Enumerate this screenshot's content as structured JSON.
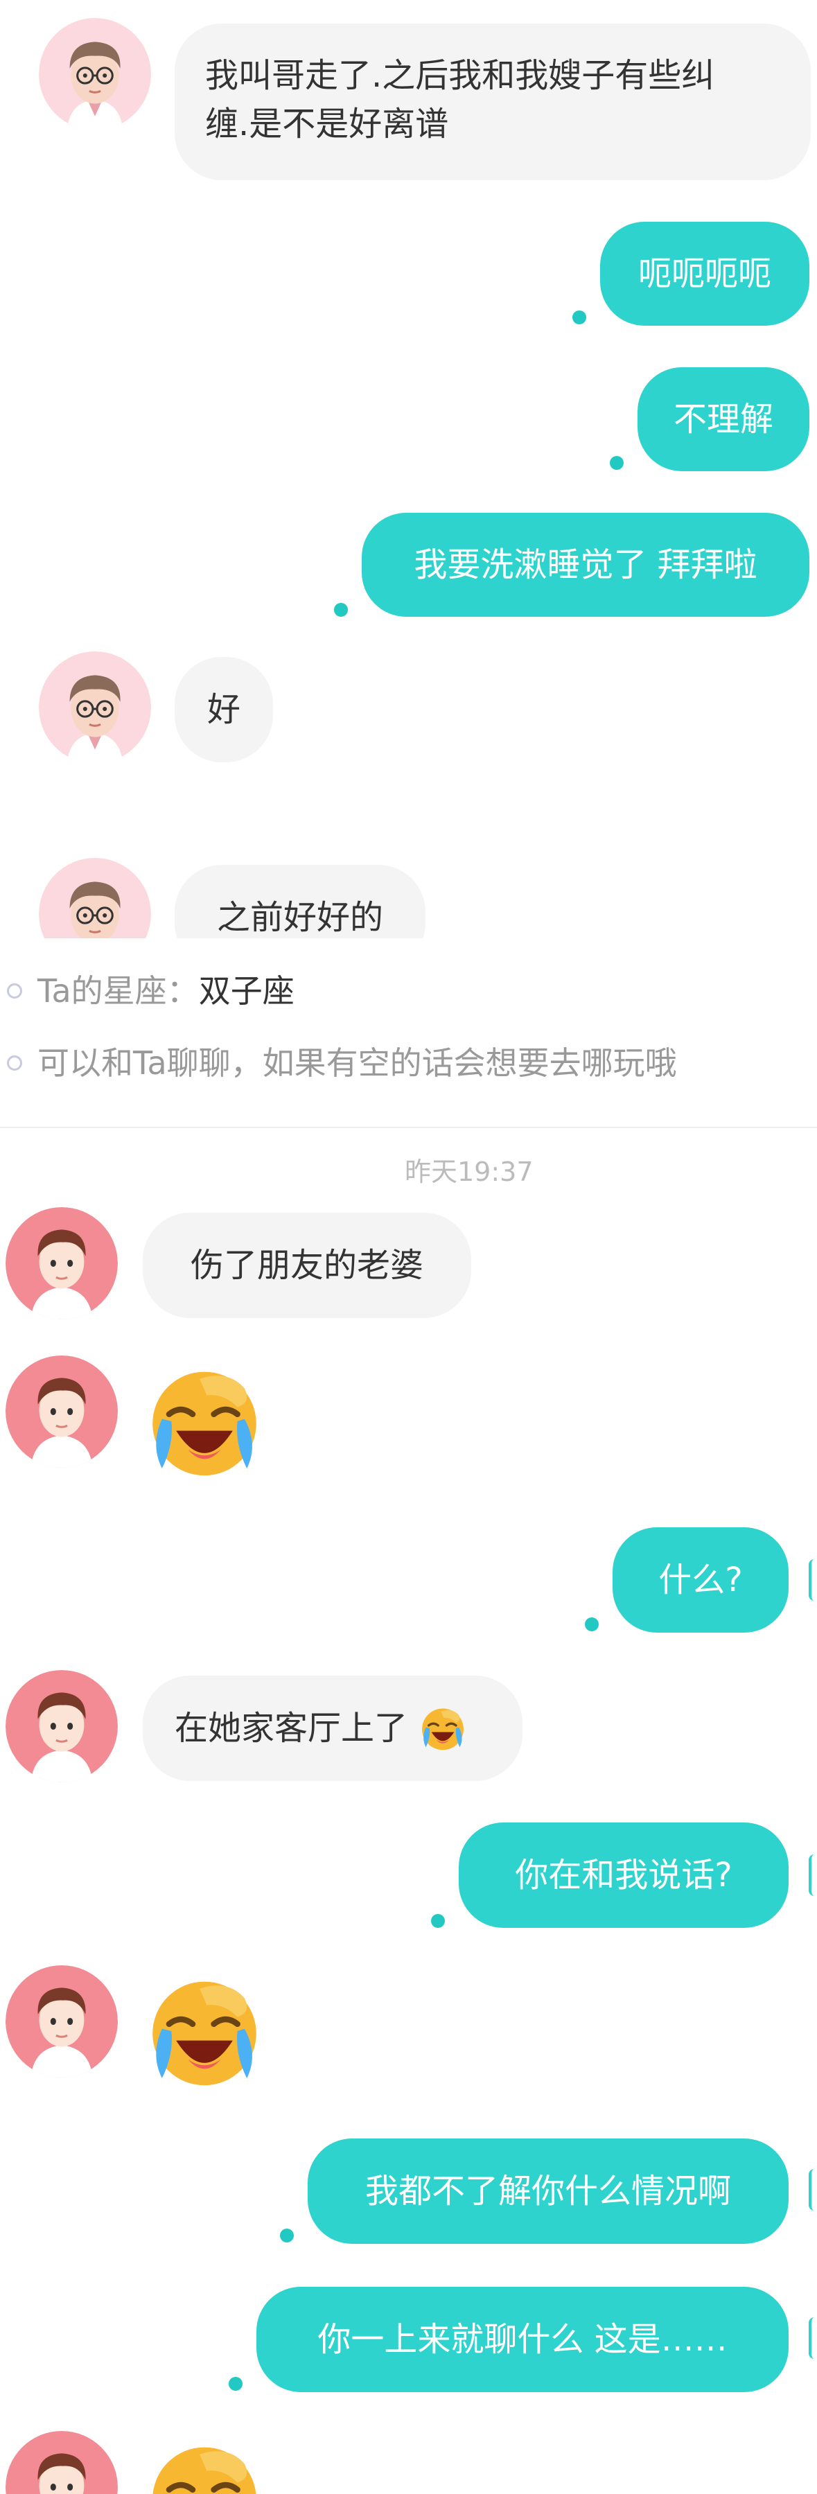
{
  "top_section": {
    "messages": [
      {
        "from": "them",
        "text": "我叫哥走了.之后我和我嫂子有些纠"
      },
      {
        "from": "them",
        "text": "缠.是不是好离谱"
      },
      {
        "from": "me",
        "text": "呃呃呃呃"
      },
      {
        "from": "me",
        "text": "不理解"
      },
      {
        "from": "me",
        "text": "我要洗漱睡觉了 拜拜啦"
      },
      {
        "from": "them",
        "text": "好"
      },
      {
        "from": "them",
        "text": "之前好好的"
      }
    ]
  },
  "profile_info": {
    "zodiac_label": "Ta的星座：",
    "zodiac_value": "双子座",
    "prompt": "可以和Ta聊聊，如果有空的话会想要去哪玩哦"
  },
  "timestamp": "昨天19:37",
  "bottom_section": {
    "messages": [
      {
        "from": "them",
        "text": "伤了朋友的老婆"
      },
      {
        "from": "them",
        "emoji": "loudly-crying-face"
      },
      {
        "from": "me",
        "text": "什么?"
      },
      {
        "from": "them",
        "text": "在她家客厅上了"
      },
      {
        "from": "me",
        "text": "你在和我说话?"
      },
      {
        "from": "them",
        "emoji": "loudly-crying-face"
      },
      {
        "from": "me",
        "text": "我都不了解你什么情况啊"
      },
      {
        "from": "me",
        "text": "你一上来就聊什么 这是……"
      },
      {
        "from": "them",
        "emoji": "loudly-crying-face"
      }
    ]
  },
  "colors": {
    "accent": "#2dd3cc",
    "incoming_bubble": "#f4f4f5",
    "avatar_male_glasses_bg": "#fbd9de",
    "avatar_young_bg": "#f28b94"
  }
}
